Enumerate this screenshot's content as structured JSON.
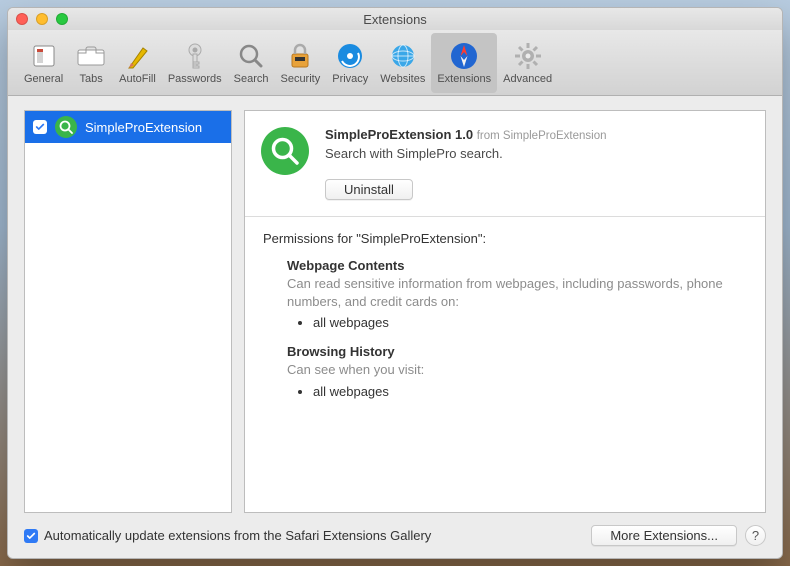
{
  "window": {
    "title": "Extensions"
  },
  "toolbar": {
    "items": [
      {
        "label": "General"
      },
      {
        "label": "Tabs"
      },
      {
        "label": "AutoFill"
      },
      {
        "label": "Passwords"
      },
      {
        "label": "Search"
      },
      {
        "label": "Security"
      },
      {
        "label": "Privacy"
      },
      {
        "label": "Websites"
      },
      {
        "label": "Extensions"
      },
      {
        "label": "Advanced"
      }
    ]
  },
  "sidebar": {
    "items": [
      {
        "name": "SimpleProExtension",
        "checked": true
      }
    ]
  },
  "detail": {
    "title": "SimpleProExtension 1.0",
    "from_label": "from SimpleProExtension",
    "description": "Search with SimplePro search.",
    "uninstall_label": "Uninstall"
  },
  "permissions": {
    "heading": "Permissions for \"SimpleProExtension\":",
    "blocks": [
      {
        "title": "Webpage Contents",
        "body": "Can read sensitive information from webpages, including passwords, phone numbers, and credit cards on:",
        "items": [
          "all webpages"
        ]
      },
      {
        "title": "Browsing History",
        "body": "Can see when you visit:",
        "items": [
          "all webpages"
        ]
      }
    ]
  },
  "footer": {
    "auto_update": "Automatically update extensions from the Safari Extensions Gallery",
    "more": "More Extensions...",
    "help": "?"
  }
}
